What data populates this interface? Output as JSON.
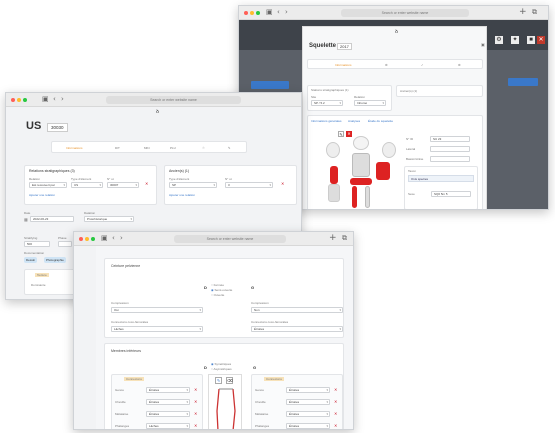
{
  "w3": {
    "url": "Search or enter website name",
    "title": "Squelette",
    "year": "2017",
    "tabs": [
      "Informations",
      "⚙",
      "✓",
      "⚙"
    ],
    "section_left": "Stations stratigraphiques (1)",
    "section_right": "Ancien(s) (1)",
    "f_label1": "Site",
    "f_val1": "SP / 5.2",
    "f_label2": "Relation",
    "f_val2": "Inhumé",
    "tab_a": "Informations générales",
    "tab_b": "Analyses",
    "tab_c": "Étude du squelette",
    "r_label1": "N° ID",
    "r_val1": "SU 23",
    "r_label2": "Latéral",
    "r_label3": "Bassin/crâne",
    "r_label4": "Sexe",
    "r_val4": "SQ0 5m 5",
    "taxon_label": "Taxon",
    "taxon_val": "Ovis species"
  },
  "w1": {
    "url": "Search or enter website name",
    "title": "US",
    "number": "30030",
    "tabs": [
      "Informations",
      "DIT",
      "MIN",
      "PLU",
      "☉",
      "✎"
    ],
    "sec_left": "Relations stratigraphiques (3)",
    "sec_right": "Ancien(s) (1)",
    "relation_label": "Relation",
    "relation_val": "Est recouvert par",
    "type_label": "Type d'élément",
    "type_val": "US",
    "num_label": "N° ut",
    "num_val": "30007",
    "r_type_label": "Type d'élément",
    "r_type_val": "SP",
    "r_num_label": "N° ut",
    "r_num_val": "3",
    "add_link": "Ajouter une relation",
    "date_label": "Date",
    "date_val": "2022-06-23",
    "state_label": "Datation",
    "state_val": "Protohistorique",
    "strat_label": "Stratifying",
    "strat_val": "500",
    "phase_label": "Phase",
    "doc_label": "Documentation",
    "chips": [
      "Dessin",
      "Photographie"
    ],
    "texture_label": "Texture",
    "dominante_label": "Dominante"
  },
  "w2": {
    "url": "Search or enter website name",
    "header_section": "Ceinture pelvienne",
    "d_letter": "D",
    "g_letter": "G",
    "radio_options": [
      "Fermée",
      "Semi-ouverte",
      "Ouverte"
    ],
    "compression_label": "Compression",
    "compression_left": "Oui",
    "compression_right": "Non",
    "connexions_label": "Connexions coxo-fémorales",
    "connexions_left": "Lâches",
    "connexions_right": "Étroites",
    "membres_section": "Membres inférieurs",
    "sym_options": [
      "Symétriques",
      "Asymétriques"
    ],
    "conn_title": "Connexions",
    "rows": [
      {
        "label": "Genou",
        "left": "Étroites",
        "right": "Étroites"
      },
      {
        "label": "Cheville",
        "left": "Étroites",
        "right": "Étroites"
      },
      {
        "label": "Métatarse",
        "left": "Étroites",
        "right": "Étroites"
      },
      {
        "label": "Phalanges",
        "left": "Lâches",
        "right": "Étroites"
      }
    ]
  }
}
